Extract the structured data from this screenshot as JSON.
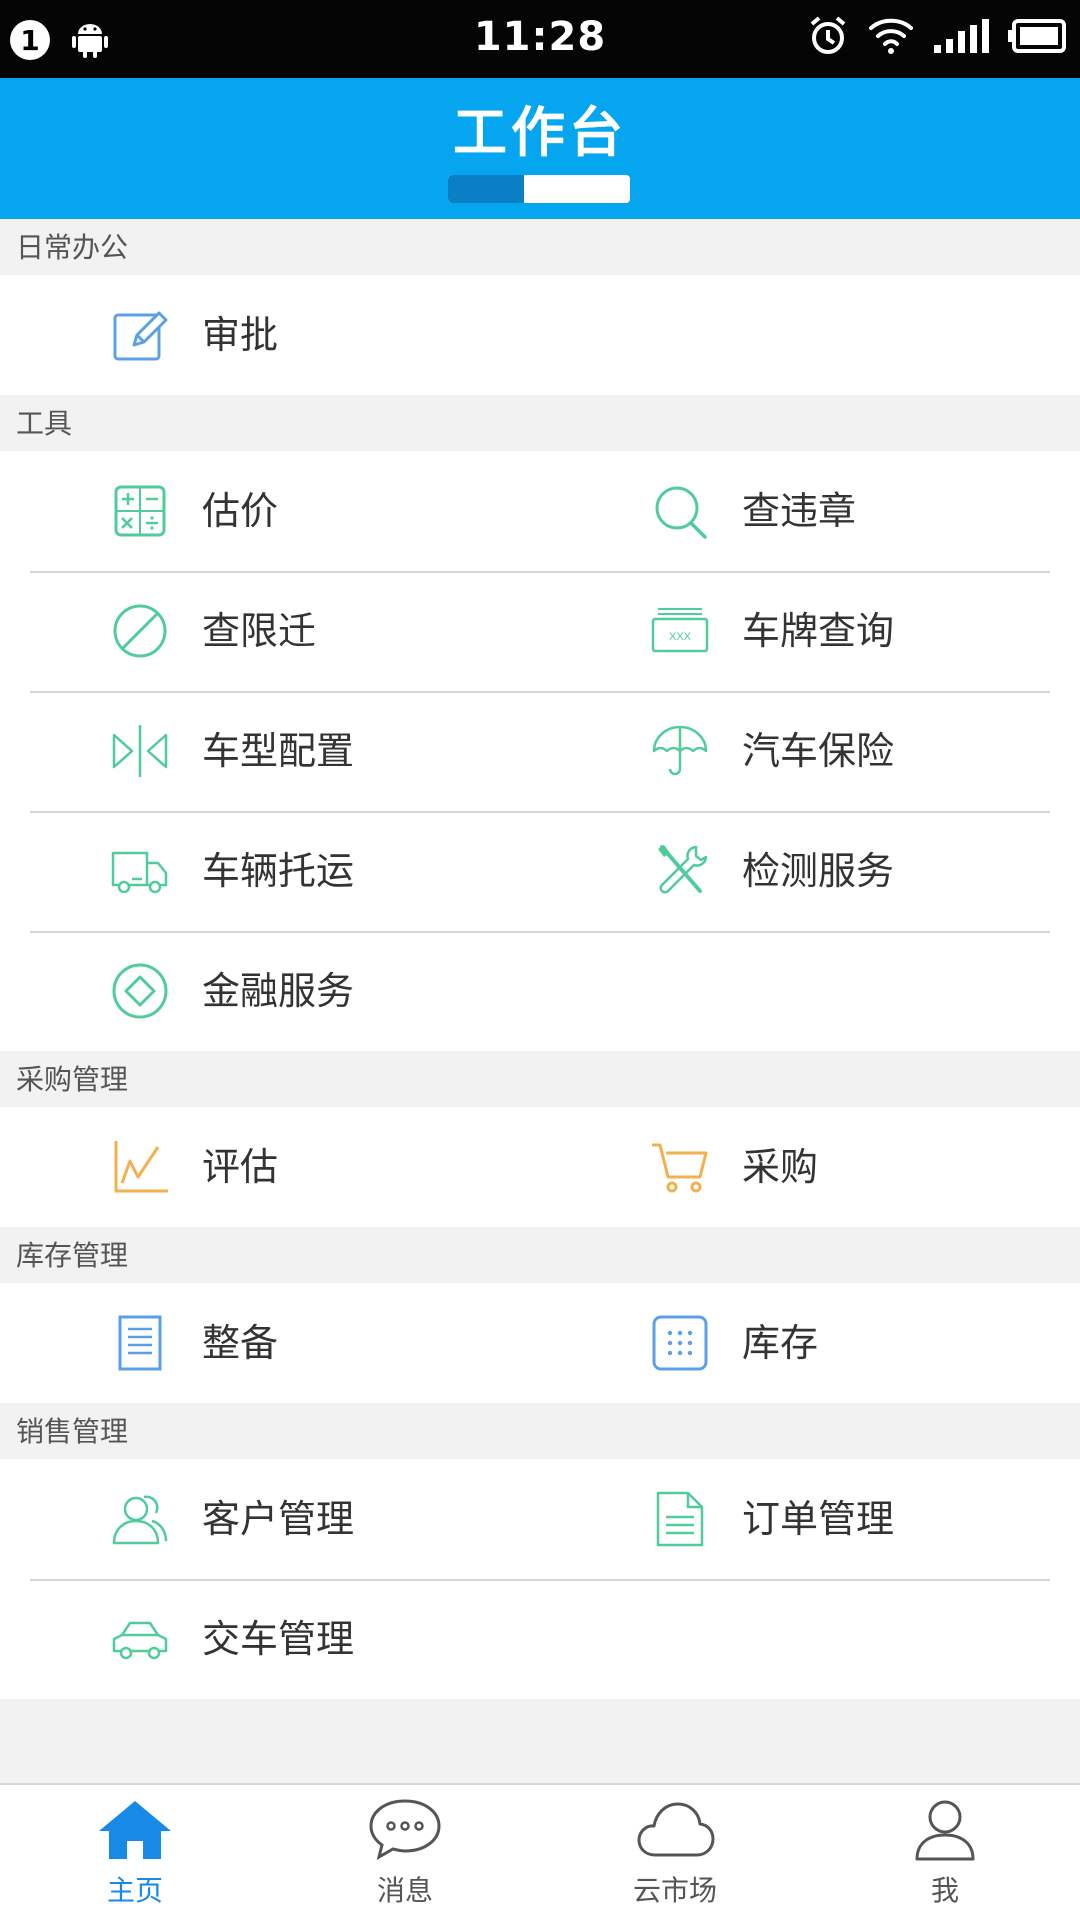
{
  "status_bar": {
    "notification_count": "1",
    "time": "11:28",
    "icons": [
      "notification-count-icon",
      "android-icon",
      "alarm-icon",
      "wifi-icon",
      "signal-icon",
      "battery-icon"
    ]
  },
  "header": {
    "title": "工作台",
    "progress_fraction": 0.42,
    "color": "#05a6ef"
  },
  "sections": [
    {
      "title": "日常办公",
      "rows": [
        [
          {
            "label": "审批",
            "icon": "edit-icon",
            "color": "#5aa0e6"
          }
        ]
      ]
    },
    {
      "title": "工具",
      "rows": [
        [
          {
            "label": "估价",
            "icon": "calculator-icon",
            "color": "#4fcc9a"
          },
          {
            "label": "查违章",
            "icon": "search-icon",
            "color": "#4fcc9a"
          }
        ],
        [
          {
            "label": "查限迁",
            "icon": "forbidden-icon",
            "color": "#4fcc9a"
          },
          {
            "label": "车牌查询",
            "icon": "license-plate-icon",
            "plate_text": "XXX",
            "color": "#4fcc9a"
          }
        ],
        [
          {
            "label": "车型配置",
            "icon": "compare-icon",
            "color": "#4fcc9a"
          },
          {
            "label": "汽车保险",
            "icon": "umbrella-icon",
            "color": "#4fcc9a"
          }
        ],
        [
          {
            "label": "车辆托运",
            "icon": "truck-icon",
            "color": "#4fcc9a"
          },
          {
            "label": "检测服务",
            "icon": "tools-icon",
            "color": "#4fcc9a"
          }
        ],
        [
          {
            "label": "金融服务",
            "icon": "finance-icon",
            "color": "#4fcc9a"
          }
        ]
      ]
    },
    {
      "title": "采购管理",
      "rows": [
        [
          {
            "label": "评估",
            "icon": "chart-icon",
            "color": "#f2b04e"
          },
          {
            "label": "采购",
            "icon": "cart-icon",
            "color": "#f2b04e"
          }
        ]
      ]
    },
    {
      "title": "库存管理",
      "rows": [
        [
          {
            "label": "整备",
            "icon": "document-icon",
            "color": "#5aa0e6"
          },
          {
            "label": "库存",
            "icon": "grid-icon",
            "color": "#5aa0e6"
          }
        ]
      ]
    },
    {
      "title": "销售管理",
      "rows": [
        [
          {
            "label": "客户管理",
            "icon": "customers-icon",
            "color": "#4fcc9a"
          },
          {
            "label": "订单管理",
            "icon": "order-icon",
            "color": "#4fcc9a"
          }
        ],
        [
          {
            "label": "交车管理",
            "icon": "car-icon",
            "color": "#4fcc9a"
          }
        ]
      ]
    }
  ],
  "bottom_nav": [
    {
      "label": "主页",
      "icon": "home-icon",
      "active": true
    },
    {
      "label": "消息",
      "icon": "chat-icon",
      "active": false
    },
    {
      "label": "云市场",
      "icon": "cloud-icon",
      "active": false
    },
    {
      "label": "我",
      "icon": "user-icon",
      "active": false
    }
  ],
  "colors": {
    "active_nav": "#1789e6",
    "inactive_nav": "#555555",
    "section_bg": "#f2f2f3"
  }
}
